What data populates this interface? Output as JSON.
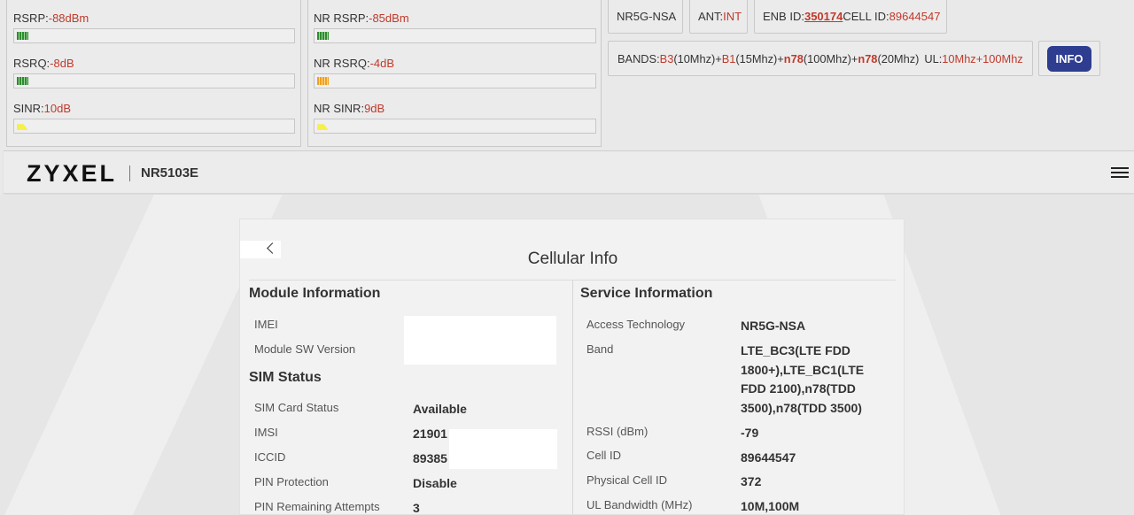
{
  "signal": {
    "lte": [
      {
        "label": "RSRP:",
        "value": "-88",
        "unit": "dBm",
        "level": 0.04,
        "color": "green"
      },
      {
        "label": "RSRQ:",
        "value": "-8",
        "unit": "dB",
        "level": 0.04,
        "color": "green"
      },
      {
        "label": "SINR:",
        "value": "10",
        "unit": "dB",
        "level": 0.04,
        "color": "yellow"
      }
    ],
    "nr": [
      {
        "label": "NR RSRP:",
        "value": "-85",
        "unit": "dBm",
        "level": 0.04,
        "color": "green"
      },
      {
        "label": "NR RSRQ:",
        "value": "-4",
        "unit": "dB",
        "level": 0.04,
        "color": "orange"
      },
      {
        "label": "NR SINR:",
        "value": "9",
        "unit": "dB",
        "level": 0.04,
        "color": "yellow"
      }
    ]
  },
  "status": {
    "mode": "NR5G-NSA",
    "ant_label": "ANT:",
    "ant_value": "INT",
    "enb_label": "ENB ID:",
    "enb_value": "350174",
    "cell_label": "CELL ID:",
    "cell_value": "89644547"
  },
  "bands": {
    "label": "BANDS:",
    "b1": "B3",
    "b1_bw": "(10Mhz)+",
    "b2": "B1",
    "b2_bw": "(15Mhz)+",
    "b3": "n78",
    "b3_bw": "(100Mhz)+",
    "b4": "n78",
    "b4_bw": "(20Mhz)",
    "ul_label": "UL:",
    "ul_value": "10Mhz+100Mhz"
  },
  "info_button": "INFO",
  "header": {
    "brand": "ZYXEL",
    "model": "NR5103E"
  },
  "card": {
    "title": "Cellular Info",
    "module": {
      "heading": "Module Information",
      "rows": [
        {
          "label": "IMEI",
          "value": ""
        },
        {
          "label": "Module SW Version",
          "value": ""
        }
      ]
    },
    "sim": {
      "heading": "SIM Status",
      "rows": [
        {
          "label": "SIM Card Status",
          "value": "Available"
        },
        {
          "label": "IMSI",
          "value": "21901"
        },
        {
          "label": "ICCID",
          "value": "89385"
        },
        {
          "label": "PIN Protection",
          "value": "Disable"
        },
        {
          "label": "PIN Remaining Attempts",
          "value": "3"
        }
      ]
    },
    "service": {
      "heading": "Service Information",
      "rows": [
        {
          "label": "Access Technology",
          "value": "NR5G-NSA"
        },
        {
          "label": "Band",
          "value": "LTE_BC3(LTE FDD 1800+),LTE_BC1(LTE FDD 2100),n78(TDD 3500),n78(TDD 3500)"
        },
        {
          "label": "RSSI (dBm)",
          "value": "-79"
        },
        {
          "label": "Cell ID",
          "value": "89644547"
        },
        {
          "label": "Physical Cell ID",
          "value": "372"
        },
        {
          "label": "UL Bandwidth (MHz)",
          "value": "10M,100M"
        }
      ]
    }
  }
}
